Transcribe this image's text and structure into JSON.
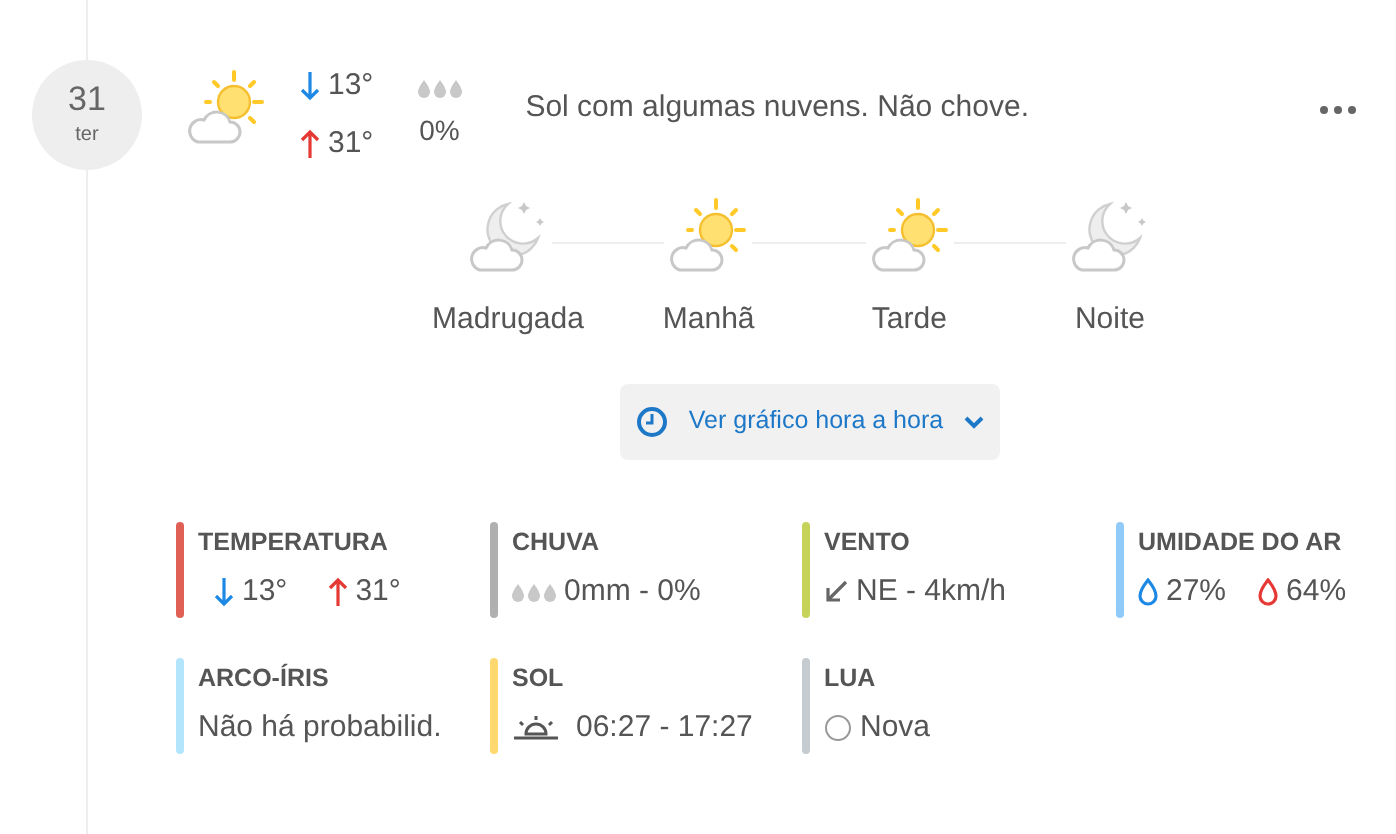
{
  "day": {
    "number": "31",
    "weekday": "ter"
  },
  "summary": {
    "kind": "day",
    "min": "13°",
    "max": "31°",
    "rain": "0%",
    "description": "Sol com algumas nuvens. Não chove."
  },
  "periods": [
    {
      "kind": "night",
      "label": "Madrugada"
    },
    {
      "kind": "day",
      "label": "Manhã"
    },
    {
      "kind": "day",
      "label": "Tarde"
    },
    {
      "kind": "night",
      "label": "Noite"
    }
  ],
  "hourly_button": {
    "label": "Ver gráfico hora a hora"
  },
  "details": [
    {
      "kind": "temperature",
      "color": "#e06055",
      "title": "TEMPERATURA",
      "values": [
        "13°",
        "31°"
      ]
    },
    {
      "kind": "rain",
      "color": "#b0b0b0",
      "title": "CHUVA",
      "values": [
        "0mm - 0%"
      ]
    },
    {
      "kind": "wind",
      "color": "#c6d35a",
      "title": "VENTO",
      "values": [
        "NE - 4km/h"
      ]
    },
    {
      "kind": "humidity",
      "color": "#90caf9",
      "title": "UMIDADE DO AR",
      "values": [
        "27%",
        "64%"
      ]
    },
    {
      "kind": "text",
      "color": "#b3e5fc",
      "title": "ARCO-ÍRIS",
      "values": [
        "Não há probabilid."
      ]
    },
    {
      "kind": "sun",
      "color": "#ffd870",
      "title": "SOL",
      "values": [
        "06:27 - 17:27"
      ]
    },
    {
      "kind": "moon",
      "color": "#c5cbd0",
      "title": "LUA",
      "values": [
        "Nova"
      ]
    }
  ]
}
